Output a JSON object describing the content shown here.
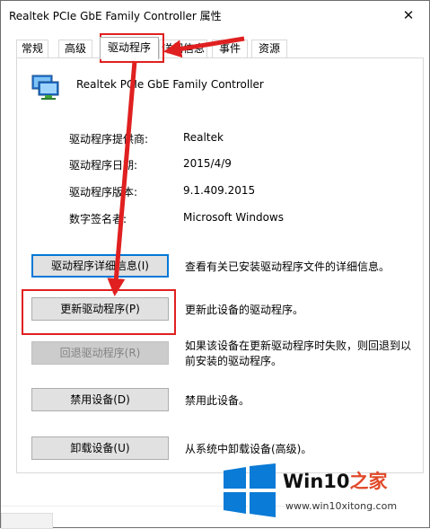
{
  "window": {
    "title": "Realtek PCIe GbE Family Controller 属性",
    "close_glyph": "✕"
  },
  "tabs": [
    {
      "label": "常规"
    },
    {
      "label": "高级"
    },
    {
      "label": "驱动程序",
      "active": true
    },
    {
      "label": "详细信息"
    },
    {
      "label": "事件"
    },
    {
      "label": "资源"
    }
  ],
  "device": {
    "name": "Realtek PCIe GbE Family Controller",
    "icon": "network-adapter-icon"
  },
  "driver_info": [
    {
      "label": "驱动程序提供商:",
      "value": "Realtek"
    },
    {
      "label": "驱动程序日期:",
      "value": "2015/4/9"
    },
    {
      "label": "驱动程序版本:",
      "value": "9.1.409.2015"
    },
    {
      "label": "数字签名者:",
      "value": "Microsoft Windows"
    }
  ],
  "actions": [
    {
      "button": "驱动程序详细信息(I)",
      "description": "查看有关已安装驱动程序文件的详细信息。"
    },
    {
      "button": "更新驱动程序(P)",
      "description": "更新此设备的驱动程序。"
    },
    {
      "button": "回退驱动程序(R)",
      "description": "如果该设备在更新驱动程序时失败，则回退到以前安装的驱动程序。",
      "disabled": true
    },
    {
      "button": "禁用设备(D)",
      "description": "禁用此设备。"
    },
    {
      "button": "卸载设备(U)",
      "description": "从系统中卸载设备(高级)。"
    }
  ],
  "watermark": {
    "brand": "Win10",
    "brand_suffix": "之家",
    "url": "www.win10xitong.com"
  },
  "colors": {
    "annotation_red": "#e02020",
    "focus_blue": "#0078d7",
    "win_logo_blue": "#0a7bd6"
  }
}
